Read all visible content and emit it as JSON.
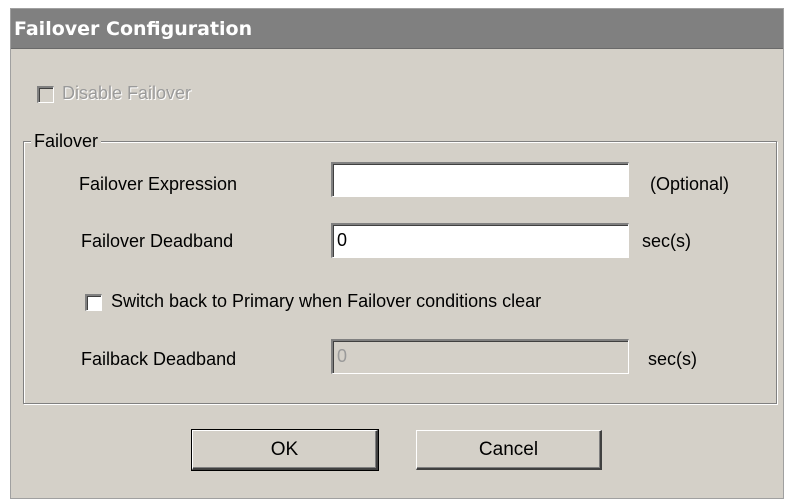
{
  "window": {
    "title": "Failover Configuration"
  },
  "disable_failover": {
    "label": "Disable Failover",
    "checked": false,
    "enabled": false
  },
  "group": {
    "label": "Failover"
  },
  "failover_expression": {
    "label": "Failover Expression",
    "value": "",
    "hint": "(Optional)"
  },
  "failover_deadband": {
    "label": "Failover Deadband",
    "value": "0",
    "unit": "sec(s)"
  },
  "switch_back": {
    "label": "Switch back to Primary when Failover conditions clear",
    "checked": false
  },
  "failback_deadband": {
    "label": "Failback Deadband",
    "value": "0",
    "unit": "sec(s)",
    "enabled": false
  },
  "buttons": {
    "ok_label": "OK",
    "cancel_label": "Cancel"
  }
}
